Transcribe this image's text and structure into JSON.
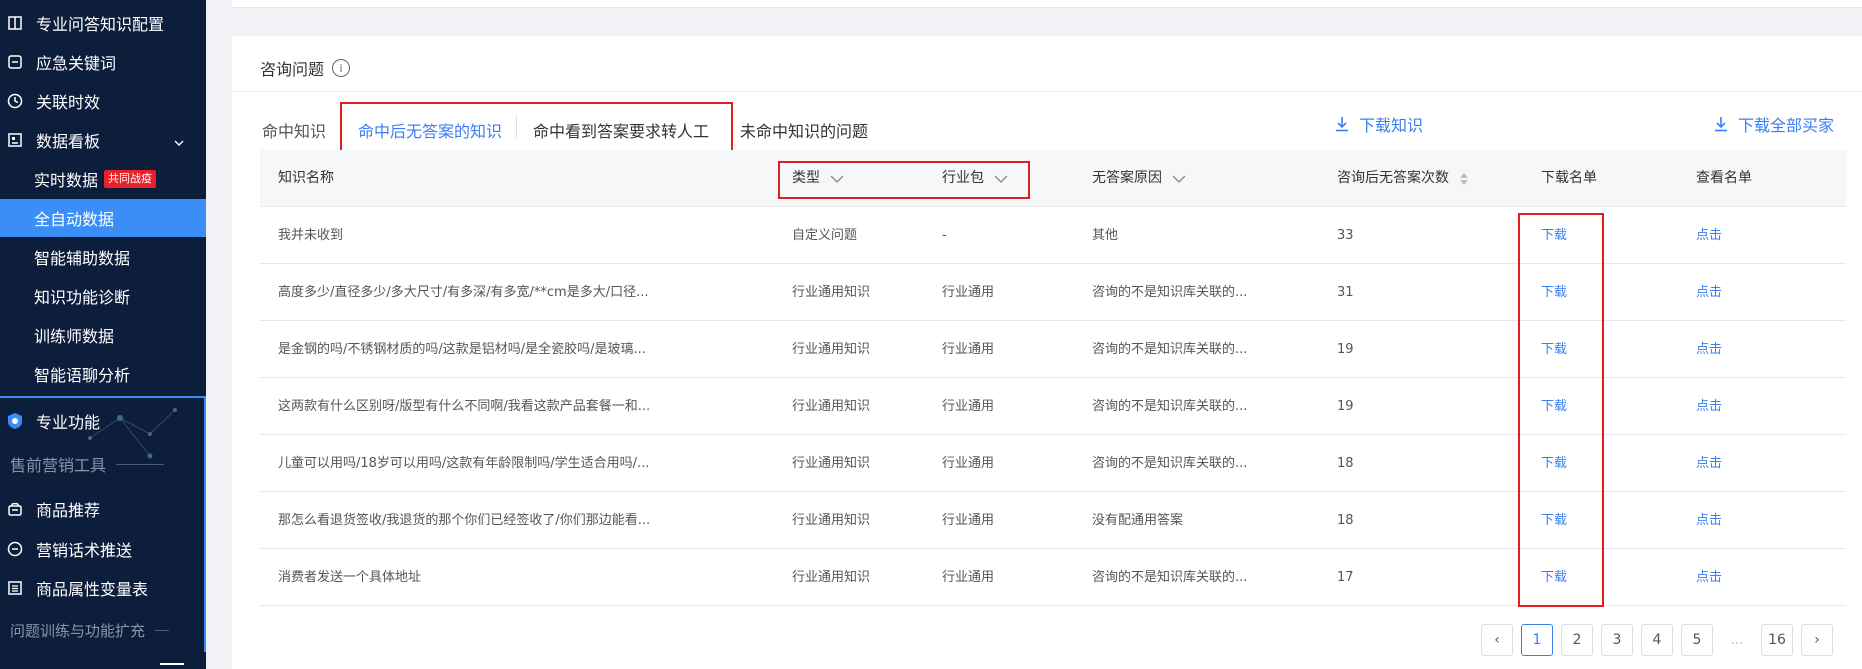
{
  "sidebar": {
    "items": [
      {
        "label": "专业问答知识配置"
      },
      {
        "label": "应急关键词"
      },
      {
        "label": "关联时效"
      },
      {
        "label": "数据看板"
      }
    ],
    "sub_items": [
      {
        "label": "实时数据",
        "badge": "共同战疫"
      },
      {
        "label": "全自动数据"
      },
      {
        "label": "智能辅助数据"
      },
      {
        "label": "知识功能诊断"
      },
      {
        "label": "训练师数据"
      },
      {
        "label": "智能语聊分析"
      }
    ],
    "pro_label": "专业功能",
    "section_presale": "售前营销工具",
    "presale_items": [
      {
        "label": "商品推荐"
      },
      {
        "label": "营销话术推送"
      },
      {
        "label": "商品属性变量表"
      }
    ],
    "section_training": "问题训练与功能扩充"
  },
  "main": {
    "card_title": "咨询问题",
    "info_symbol": "i",
    "tabs": {
      "label": "命中知识",
      "items": [
        {
          "label": "命中后无答案的知识",
          "active": true
        },
        {
          "label": "命中看到答案要求转人工",
          "active": false
        },
        {
          "label": "未命中知识的问题",
          "active": false
        }
      ]
    },
    "download_knowledge": "下载知识",
    "download_all_buyers": "下载全部买家",
    "table": {
      "headers": [
        "知识名称",
        "类型",
        "行业包",
        "无答案原因",
        "咨询后无答案次数",
        "下载名单",
        "查看名单"
      ],
      "rows": [
        {
          "name": "我并未收到",
          "type": "自定义问题",
          "industry": "-",
          "reason": "其他",
          "count": "33",
          "download": "下载",
          "view": "点击"
        },
        {
          "name": "高度多少/直径多少/多大尺寸/有多深/有多宽/**cm是多大/口径...",
          "type": "行业通用知识",
          "industry": "行业通用",
          "reason": "咨询的不是知识库关联的...",
          "count": "31",
          "download": "下载",
          "view": "点击"
        },
        {
          "name": "是金钢的吗/不锈钢材质的吗/这款是铝材吗/是全瓷胶吗/是玻璃...",
          "type": "行业通用知识",
          "industry": "行业通用",
          "reason": "咨询的不是知识库关联的...",
          "count": "19",
          "download": "下载",
          "view": "点击"
        },
        {
          "name": "这两款有什么区别呀/版型有什么不同啊/我看这款产品套餐一和...",
          "type": "行业通用知识",
          "industry": "行业通用",
          "reason": "咨询的不是知识库关联的...",
          "count": "19",
          "download": "下载",
          "view": "点击"
        },
        {
          "name": "儿童可以用吗/18岁可以用吗/这款有年龄限制吗/学生适合用吗/...",
          "type": "行业通用知识",
          "industry": "行业通用",
          "reason": "咨询的不是知识库关联的...",
          "count": "18",
          "download": "下载",
          "view": "点击"
        },
        {
          "name": "那怎么看退货签收/我退货的那个你们已经签收了/你们那边能看...",
          "type": "行业通用知识",
          "industry": "行业通用",
          "reason": "没有配通用答案",
          "count": "18",
          "download": "下载",
          "view": "点击"
        },
        {
          "name": "消费者发送一个具体地址",
          "type": "行业通用知识",
          "industry": "行业通用",
          "reason": "咨询的不是知识库关联的...",
          "count": "17",
          "download": "下载",
          "view": "点击"
        }
      ]
    },
    "pagination": {
      "prev": "‹",
      "pages": [
        "1",
        "2",
        "3",
        "4",
        "5"
      ],
      "ellipsis": "...",
      "last": "16",
      "next": "›",
      "current": "1"
    }
  },
  "colors": {
    "sidebar_bg": "#0c1e3c",
    "active_blue": "#3a8ef6",
    "link_blue": "#3a7ff3",
    "annotation_red": "#e02020",
    "badge_red": "#e8202a"
  }
}
